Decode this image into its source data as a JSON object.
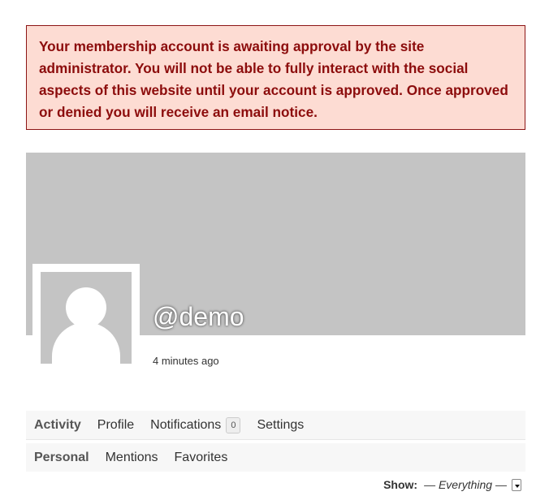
{
  "notice": {
    "text": "Your membership account is awaiting approval by the site administrator. You will not be able to fully interact with the social aspects of this website until your account is approved. Once approved or denied you will receive an email notice."
  },
  "profile": {
    "username": "@demo",
    "last_active": "4 minutes ago"
  },
  "primary_nav": {
    "items": [
      {
        "label": "Activity"
      },
      {
        "label": "Profile"
      },
      {
        "label": "Notifications",
        "count": "0"
      },
      {
        "label": "Settings"
      }
    ]
  },
  "sub_nav": {
    "items": [
      {
        "label": "Personal"
      },
      {
        "label": "Mentions"
      },
      {
        "label": "Favorites"
      }
    ]
  },
  "filter": {
    "label": "Show:",
    "value": "— Everything —"
  },
  "colors": {
    "notice_bg": "#fddcd3",
    "notice_text": "#8c0c0c",
    "cover": "#c4c4c4"
  }
}
